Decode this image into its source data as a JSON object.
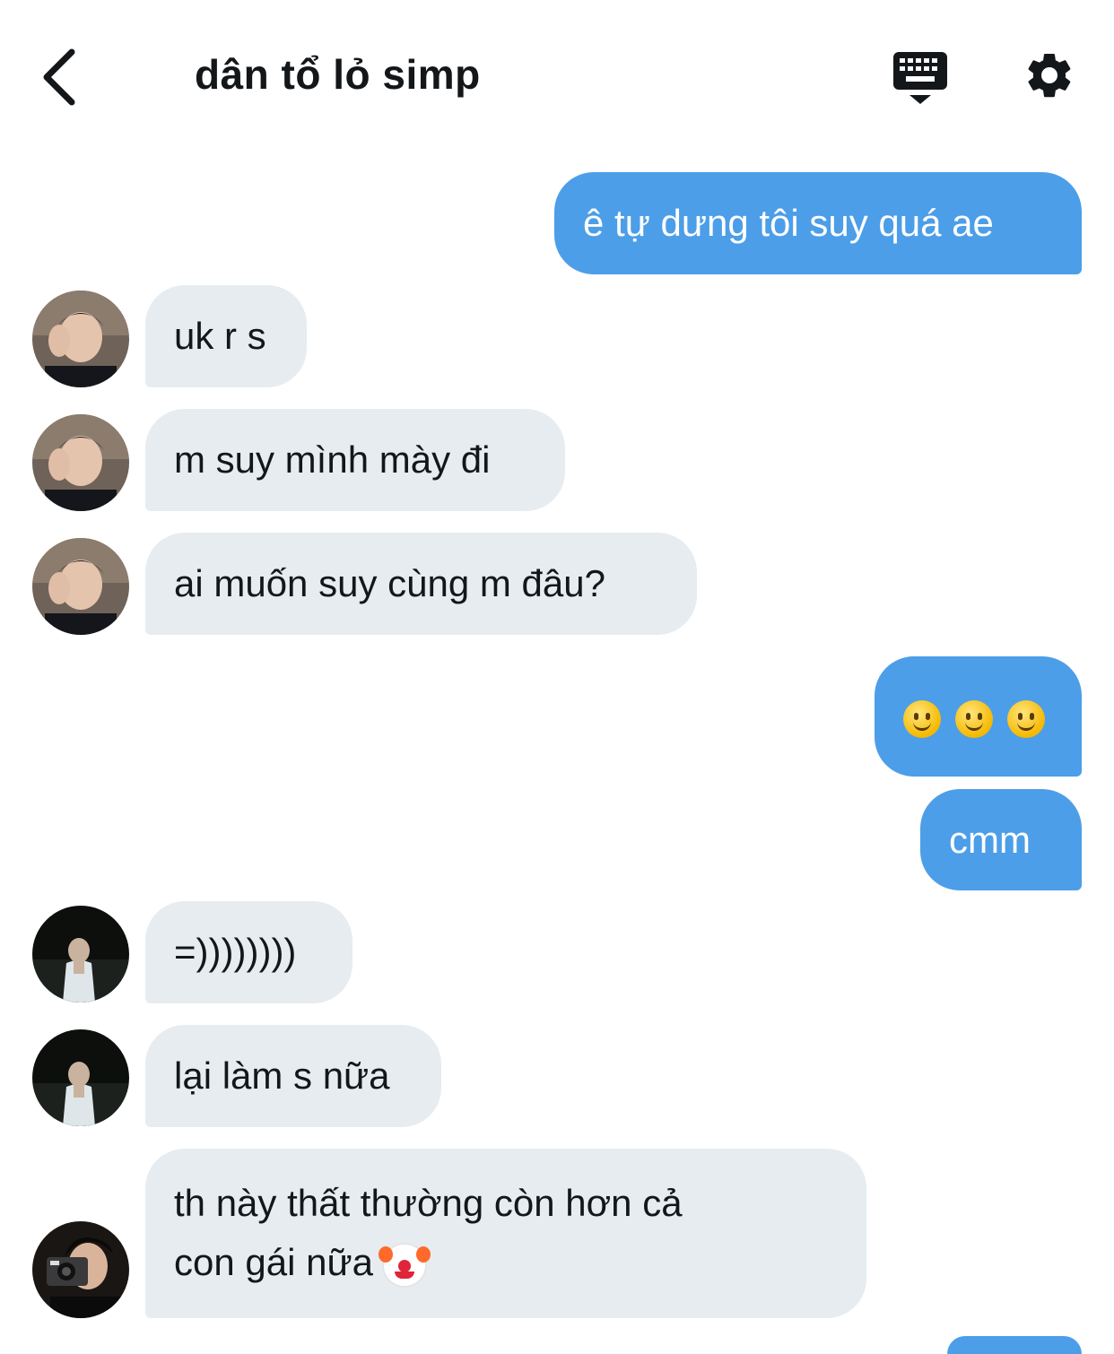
{
  "header": {
    "title": "dân tổ lỏ simp",
    "back_icon": "chevron-left-icon",
    "keyboard_icon": "keyboard-icon",
    "settings_icon": "gear-icon"
  },
  "colors": {
    "outgoing_bubble": "#4c9ee8",
    "incoming_bubble": "#e6ecf0",
    "text": "#14171a"
  },
  "messages": [
    {
      "direction": "outgoing",
      "text": "ê tự dưng tôi suy quá ae"
    },
    {
      "direction": "incoming",
      "sender_avatar": "avatar-user-a",
      "text": "uk r s"
    },
    {
      "direction": "incoming",
      "sender_avatar": "avatar-user-a",
      "text": "m suy mình mày đi"
    },
    {
      "direction": "incoming",
      "sender_avatar": "avatar-user-a",
      "text": "ai muốn suy cùng m đâu?"
    },
    {
      "direction": "outgoing",
      "text": "",
      "emoji": [
        "slightly-smiling-face-icon",
        "slightly-smiling-face-icon",
        "slightly-smiling-face-icon"
      ]
    },
    {
      "direction": "outgoing",
      "text": "cmm"
    },
    {
      "direction": "incoming",
      "sender_avatar": "avatar-user-b",
      "text": "=))))))))"
    },
    {
      "direction": "incoming",
      "sender_avatar": "avatar-user-b",
      "text": "lại làm s nữa"
    },
    {
      "direction": "incoming",
      "sender_avatar": "avatar-user-c",
      "text_line1": "th này thất thường còn hơn cả",
      "text_line2": "con gái nữa",
      "emoji": [
        "clown-face-icon"
      ]
    }
  ]
}
